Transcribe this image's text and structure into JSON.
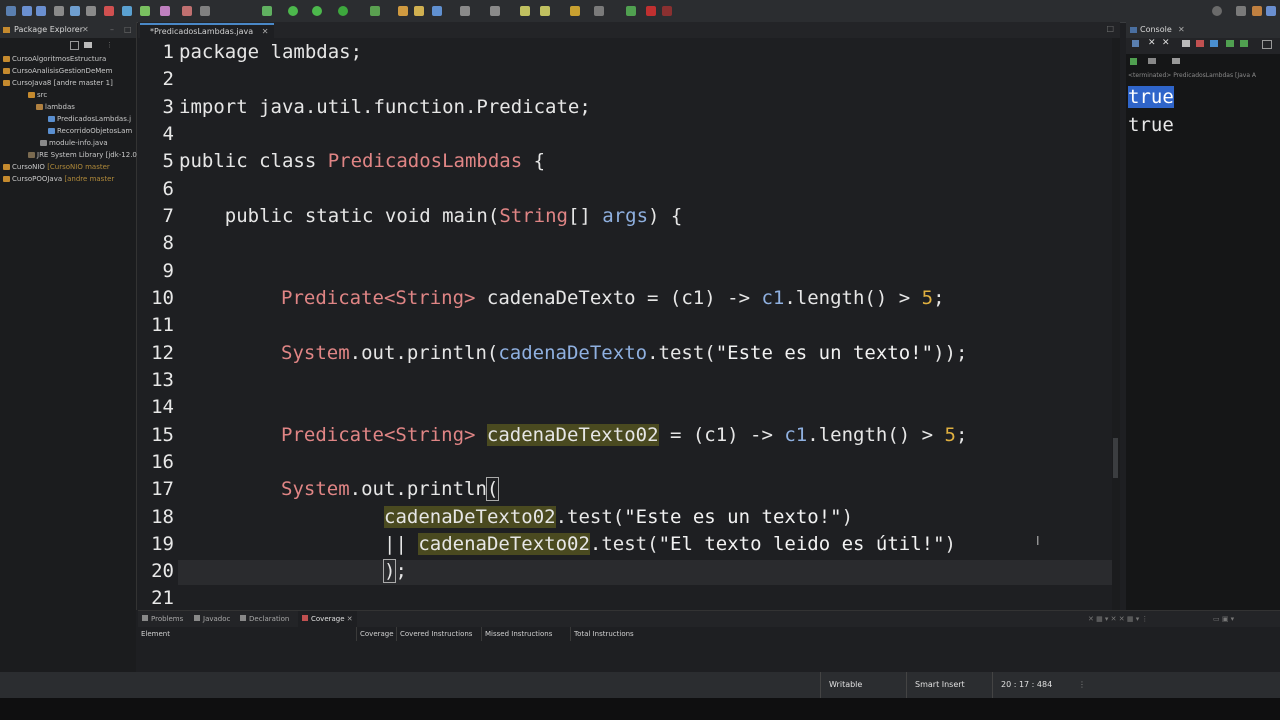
{
  "editor": {
    "tab_label": "*PredicadosLambdas.java",
    "lines": [
      "1",
      "2",
      "3",
      "4",
      "5",
      "6",
      "7",
      "8",
      "9",
      "10",
      "11",
      "12",
      "13",
      "14",
      "15",
      "16",
      "17",
      "18",
      "19",
      "20",
      "21"
    ],
    "code": {
      "l1_kw": "package",
      "l1_rest": " lambdas;",
      "l3_kw": "import",
      "l3_rest": " java.util.function.Predicate;",
      "l5_kw": "public class ",
      "l5_cls": "PredicadosLambdas",
      "l5_rest": " {",
      "l7_kw": "    public static void ",
      "l7_main": "main(",
      "l7_ty": "String",
      "l7_rest1": "[] ",
      "l7_args": "args",
      "l7_rest2": ") {",
      "l10_ty": "Predicate",
      "l10_gen": "<String>",
      "l10_var": " cadenaDeTexto = (c1) -> ",
      "l10_c1": "c1",
      "l10_rest": ".length() > ",
      "l10_num": "5",
      "l10_end": ";",
      "l12_ty": "System",
      "l12_mid": ".out.println(",
      "l12_var": "cadenaDeTexto",
      "l12_rest": ".test(",
      "l12_str": "\"Este es un texto!\"",
      "l12_end": "));",
      "l15_ty": "Predicate",
      "l15_gen": "<String>",
      "l15_var": "cadenaDeTexto02",
      "l15_rest": " = (c1) -> ",
      "l15_c1": "c1",
      "l15_rest2": ".length() > ",
      "l15_num": "5",
      "l15_end": ";",
      "l17_ty": "System",
      "l17_mid": ".out.println",
      "l17_par": "(",
      "l18_var": "cadenaDeTexto02",
      "l18_rest": ".test(",
      "l18_str": "\"Este es un texto!\"",
      "l18_end": ")",
      "l19_or": "|| ",
      "l19_var": "cadenaDeTexto02",
      "l19_rest": ".test(",
      "l19_str": "\"El texto leido es útil!\"",
      "l19_end": ")",
      "l20_par": ")",
      "l20_end": ";"
    }
  },
  "package_explorer": {
    "title": "Package Explorer",
    "items": [
      "CursoAlgoritmosEstructura",
      "CursoAnalisisGestionDeMem",
      "CursoJava8 [andre master 1]",
      "src",
      "lambdas",
      "PredicadosLambdas.j",
      "RecorridoObjetosLam",
      "module-info.java",
      "JRE System Library [jdk-12.0",
      "CursoNIO",
      "[CursoNIO master",
      "CursoPOOJava",
      "[andre master"
    ]
  },
  "console": {
    "title": "Console",
    "terminated": "<terminated> PredicadosLambdas [Java A",
    "output": [
      "true",
      "true"
    ]
  },
  "bottom_panel": {
    "tabs": [
      "Problems",
      "Javadoc",
      "Declaration",
      "Coverage"
    ],
    "columns": [
      "Element",
      "Coverage",
      "Covered Instructions",
      "Missed Instructions",
      "Total Instructions"
    ]
  },
  "status_bar": {
    "writable": "Writable",
    "insert_mode": "Smart Insert",
    "position": "20 : 17 : 484"
  },
  "colors": {
    "accent": "#4a88c7",
    "type": "#e08585",
    "variable": "#8fb0e0",
    "string": "#f2f2f2",
    "number": "#e0b040",
    "selection": "#2f65ca"
  }
}
